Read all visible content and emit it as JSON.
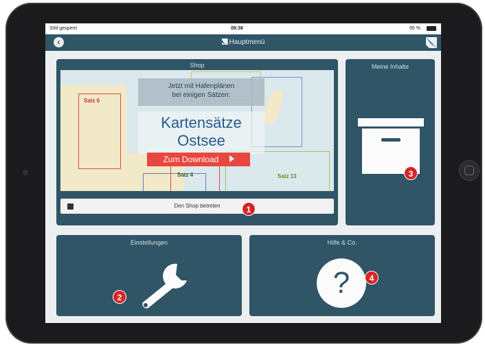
{
  "status_bar": {
    "carrier": "SIM gesperrt",
    "time": "08:38",
    "battery": "95 %"
  },
  "nav": {
    "title": "Hauptmenü"
  },
  "shop": {
    "title": "Shop",
    "promo_line1": "Jetzt mit Hafenplänen",
    "promo_line2": "bei einigen Sätzen:",
    "headline1": "Kartensätze",
    "headline2": "Ostsee",
    "download_label": "Zum Download",
    "enter_label": "Den Shop betreten",
    "map_labels": {
      "satz6": "Satz 6",
      "satz4": "Satz 4",
      "satz13": "Satz 13"
    }
  },
  "my_content": {
    "title": "Meine Inhalte"
  },
  "settings": {
    "title": "Einstellungen"
  },
  "help": {
    "title": "Hilfe & Co.",
    "icon_text": "?"
  },
  "badges": [
    "1",
    "2",
    "3",
    "4"
  ],
  "colors": {
    "tile": "#2f5566",
    "badge": "#d82327",
    "download": "#e8473f"
  }
}
